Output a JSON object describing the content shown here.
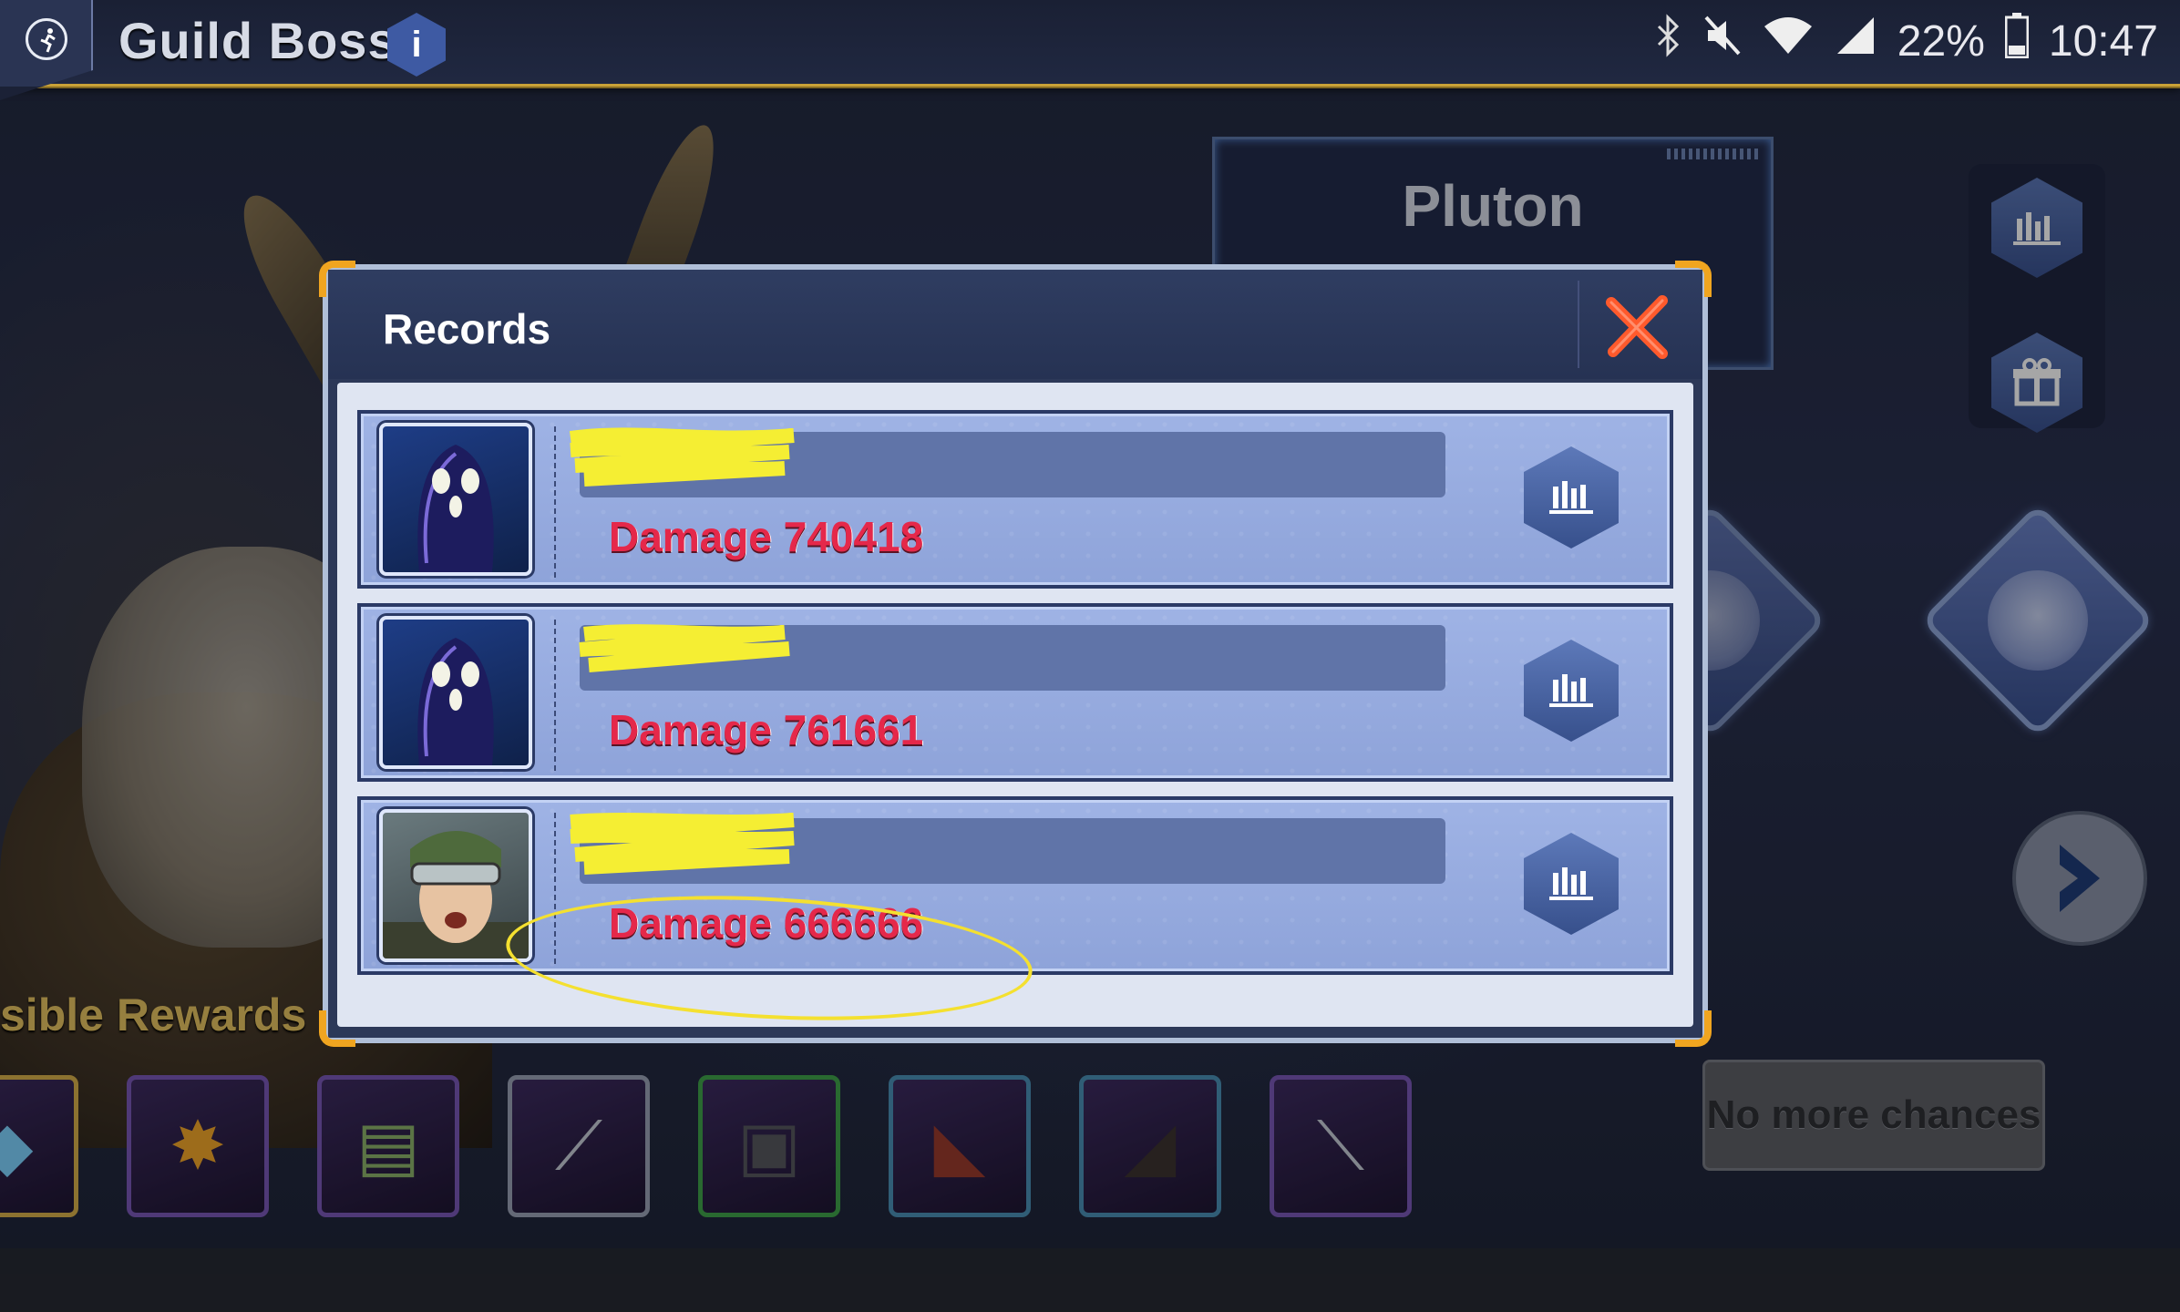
{
  "topbar": {
    "title": "Guild Boss",
    "info_label": "i",
    "battery": "22%",
    "time": "10:47"
  },
  "boss_panel": {
    "name": "Pluton"
  },
  "rewards": {
    "title": "sible Rewards",
    "items": [
      {
        "icon": "crystal-icon",
        "glyph": "◆",
        "color": "#7fd3ff",
        "border": "#d8b04a"
      },
      {
        "icon": "medal-icon",
        "glyph": "✸",
        "color": "#f2a62a",
        "border": "#7a58b7"
      },
      {
        "icon": "cash-icon",
        "glyph": "▤",
        "color": "#8db26b",
        "border": "#7a58b7"
      },
      {
        "icon": "knife-icon",
        "glyph": "⟋",
        "color": "#c7ccd7",
        "border": "#9aa2b5"
      },
      {
        "icon": "jacket-icon",
        "glyph": "▣",
        "color": "#56585e",
        "border": "#3fa14a"
      },
      {
        "icon": "shorts-icon",
        "glyph": "◣",
        "color": "#9a3b2d",
        "border": "#4a8fb5"
      },
      {
        "icon": "boots-icon",
        "glyph": "◢",
        "color": "#3d3330",
        "border": "#4a8fb5"
      },
      {
        "icon": "sword-icon",
        "glyph": "⟍",
        "color": "#c7ccd7",
        "border": "#7a58b7"
      }
    ]
  },
  "no_chances_label": "No more chances",
  "modal": {
    "title": "Records",
    "records": [
      {
        "avatar": "alien-avatar",
        "damage_label": "Damage 740418"
      },
      {
        "avatar": "alien-avatar",
        "damage_label": "Damage 761661"
      },
      {
        "avatar": "soldier-avatar",
        "damage_label": "Damage 666666"
      }
    ]
  },
  "colors": {
    "accent_gold": "#c9a137",
    "corner_orange": "#f0a520",
    "damage_red": "#e5284a",
    "highlight_yellow": "#f4e030"
  }
}
